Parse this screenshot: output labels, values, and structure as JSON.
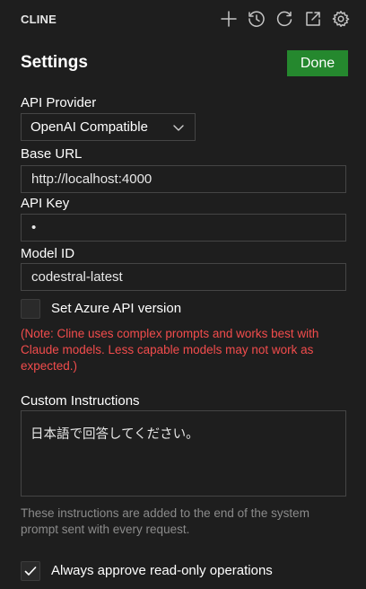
{
  "app": {
    "title": "CLINE"
  },
  "toolbar": {
    "icons": [
      "plus-icon",
      "history-icon",
      "refresh-icon",
      "external-link-icon",
      "gear-icon"
    ]
  },
  "settings": {
    "title": "Settings",
    "done_label": "Done",
    "api_provider": {
      "label": "API Provider",
      "value": "OpenAI Compatible"
    },
    "base_url": {
      "label": "Base URL",
      "value": "http://localhost:4000"
    },
    "api_key": {
      "label": "API Key",
      "value": "•"
    },
    "model_id": {
      "label": "Model ID",
      "value": "codestral-latest"
    },
    "azure": {
      "label": "Set Azure API version",
      "checked": false
    },
    "note": "(Note: Cline uses complex prompts and works best with Claude models. Less capable models may not work as expected.)",
    "custom_instructions": {
      "label": "Custom Instructions",
      "value": "日本語で回答してください。",
      "help": "These instructions are added to the end of the system prompt sent with every request."
    },
    "always_approve": {
      "label": "Always approve read-only operations",
      "checked": true
    }
  },
  "colors": {
    "background": "#1e1e1e",
    "done_button": "#25882e",
    "note_text": "#f14c4c",
    "help_text": "#8b8b8b",
    "border": "#454545"
  }
}
